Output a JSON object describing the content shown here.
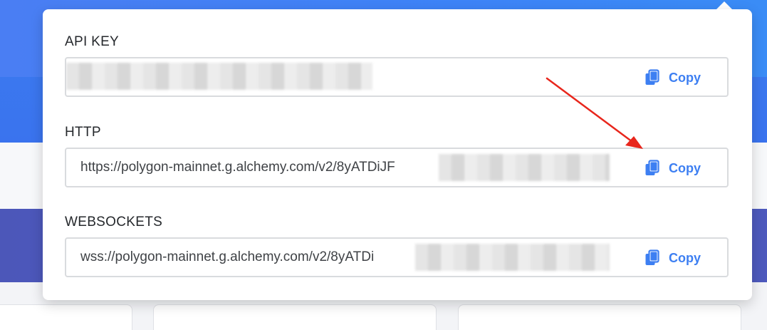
{
  "popover": {
    "fields": [
      {
        "label": "API KEY",
        "value": "",
        "copy_label": "Copy"
      },
      {
        "label": "HTTP",
        "value": "https://polygon-mainnet.g.alchemy.com/v2/8yATDiJF",
        "copy_label": "Copy"
      },
      {
        "label": "WEBSOCKETS",
        "value": "wss://polygon-mainnet.g.alchemy.com/v2/8yATDi",
        "copy_label": "Copy"
      }
    ]
  },
  "colors": {
    "accent": "#3d7ff2",
    "annotation_arrow": "#e8261c",
    "header_blue": "#3d7ff2",
    "band_purple": "#4a58c2"
  },
  "icons": {
    "copy": "copy-icon"
  }
}
